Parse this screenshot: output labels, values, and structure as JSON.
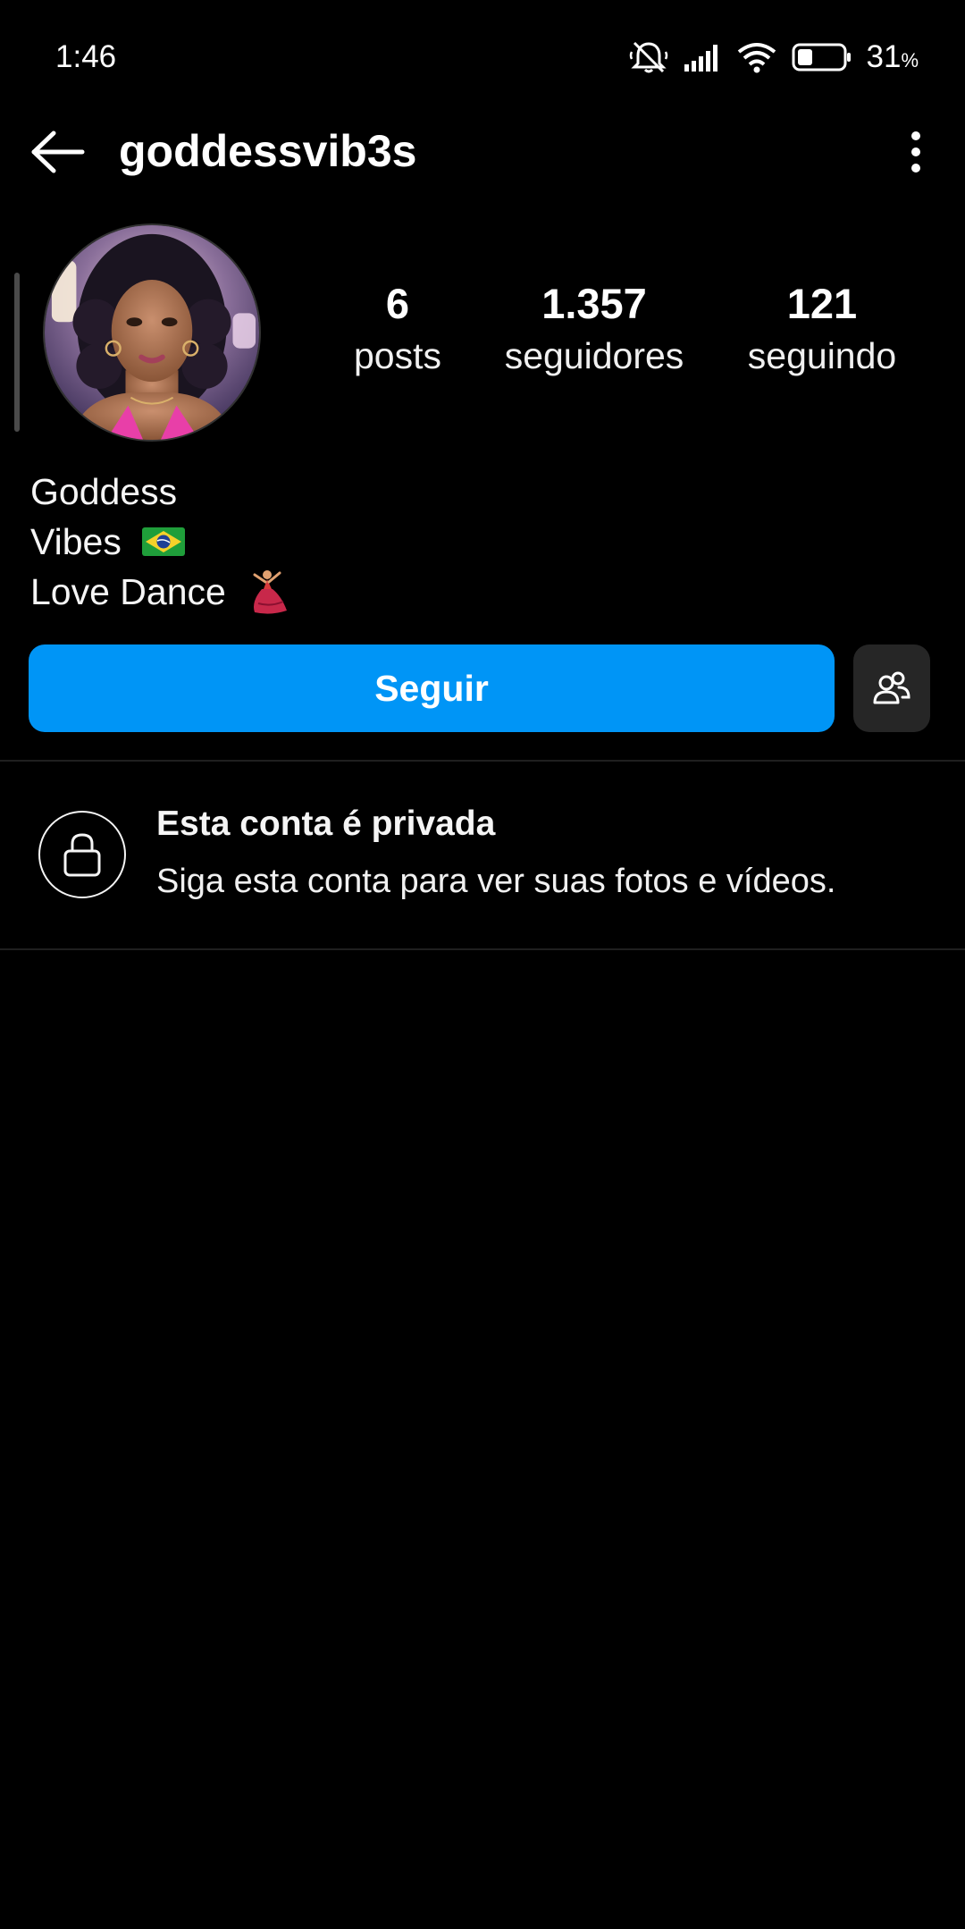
{
  "status_bar": {
    "time": "1:46",
    "battery_level": "31",
    "battery_unit": "%",
    "icons": [
      "muted-bell-icon",
      "signal-icon",
      "wifi-icon",
      "battery-icon"
    ]
  },
  "header": {
    "username": "goddessvib3s",
    "icons": [
      "back-arrow-icon",
      "more-vertical-icon"
    ]
  },
  "profile": {
    "stats": {
      "posts_count": "6",
      "posts_label": "posts",
      "followers_count": "1.357",
      "followers_label": "seguidores",
      "following_count": "121",
      "following_label": "seguindo"
    },
    "bio": {
      "line1": "Goddess",
      "line2": "Vibes",
      "line3": "Love Dance"
    }
  },
  "actions": {
    "follow_label": "Seguir",
    "suggest_icon": "add-people-icon",
    "follow_color": "#0095f6"
  },
  "private_notice": {
    "title": "Esta conta é privada",
    "subtitle": "Siga esta conta para ver suas fotos e vídeos.",
    "icon": "lock-icon"
  },
  "colors": {
    "background": "#000000",
    "accent": "#0095f6",
    "secondary_button": "#262626"
  }
}
